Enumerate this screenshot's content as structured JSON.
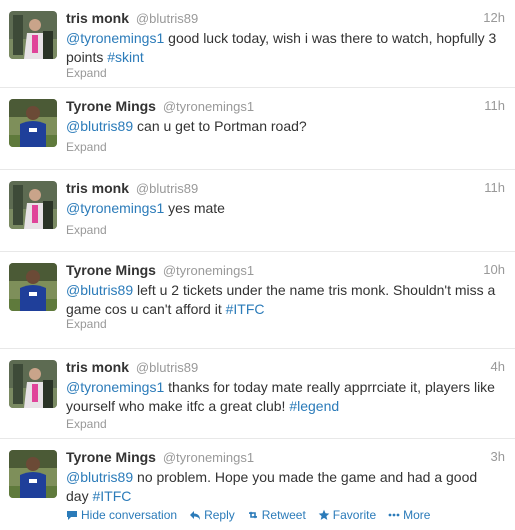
{
  "tweets": [
    {
      "name": "tris monk",
      "handle": "@blutris89",
      "time": "12h",
      "text": [
        {
          "t": "@tyronemings1",
          "m": true
        },
        {
          "t": " good luck today, wish i was there to watch, hopfully 3 points ",
          "m": false
        },
        {
          "t": "#skint",
          "m": true
        }
      ],
      "expand": "Expand"
    },
    {
      "name": "Tyrone Mings",
      "handle": "@tyronemings1",
      "time": "11h",
      "text": [
        {
          "t": "@blutris89",
          "m": true
        },
        {
          "t": " can u get to Portman road?",
          "m": false
        }
      ],
      "expand": "Expand"
    },
    {
      "name": "tris monk",
      "handle": "@blutris89",
      "time": "11h",
      "text": [
        {
          "t": "@tyronemings1",
          "m": true
        },
        {
          "t": " yes mate",
          "m": false
        }
      ],
      "expand": "Expand"
    },
    {
      "name": "Tyrone Mings",
      "handle": "@tyronemings1",
      "time": "10h",
      "text": [
        {
          "t": "@blutris89",
          "m": true
        },
        {
          "t": " left u 2 tickets under the name tris monk. Shouldn't miss a game cos u can't afford it ",
          "m": false
        },
        {
          "t": "#ITFC",
          "m": true
        }
      ],
      "expand": "Expand"
    },
    {
      "name": "tris monk",
      "handle": "@blutris89",
      "time": "4h",
      "text": [
        {
          "t": "@tyronemings1",
          "m": true
        },
        {
          "t": " thanks for today mate really apprrciate it, players like yourself who make itfc a great club! ",
          "m": false
        },
        {
          "t": "#legend",
          "m": true
        }
      ],
      "expand": "Expand"
    },
    {
      "name": "Tyrone Mings",
      "handle": "@tyronemings1",
      "time": "3h",
      "text": [
        {
          "t": "@blutris89",
          "m": true
        },
        {
          "t": " no problem. Hope you made the game and had a good day ",
          "m": false
        },
        {
          "t": "#ITFC",
          "m": true
        }
      ],
      "actions": {
        "hide": "Hide conversation",
        "reply": "Reply",
        "retweet": "Retweet",
        "favorite": "Favorite",
        "more": "More"
      }
    }
  ],
  "colors": {
    "link": "#2b7bb9",
    "muted": "#999999",
    "text": "#333333",
    "border": "#e8e8e8"
  }
}
